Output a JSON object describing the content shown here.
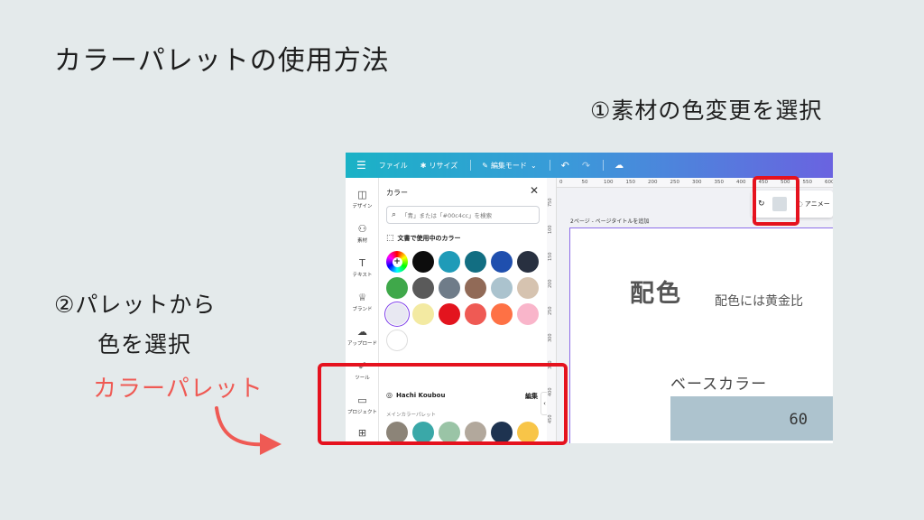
{
  "slide": {
    "title": "カラーパレットの使用方法",
    "step1": "①素材の色変更を選択",
    "step2_line1": "②パレットから",
    "step2_line2": "色を選択",
    "palette_label": "カラーパレット",
    "accent": "#ef5a54",
    "highlight": "#e5121e"
  },
  "topbar": {
    "menu_icon": "hamburger-icon",
    "file": "ファイル",
    "resize": "リサイズ",
    "edit_mode": "編集モード",
    "gradient_from": "#1ab2c6",
    "gradient_to": "#6a63e0"
  },
  "nav": [
    {
      "label": "デザイン",
      "icon": "design-icon"
    },
    {
      "label": "素材",
      "icon": "elements-icon"
    },
    {
      "label": "テキスト",
      "icon": "text-icon"
    },
    {
      "label": "ブランド",
      "icon": "brand-icon"
    },
    {
      "label": "アップロード",
      "icon": "upload-icon"
    },
    {
      "label": "ツール",
      "icon": "tools-icon"
    },
    {
      "label": "プロジェクト",
      "icon": "folder-icon"
    },
    {
      "label": "",
      "icon": "apps-icon"
    }
  ],
  "panel": {
    "header": "カラー",
    "search_placeholder": "「青」または「#00c4cc」を検索",
    "doc_colors_title": "文書で使用中のカラー",
    "doc_colors": [
      "#0d0d0d",
      "#1f9bb8",
      "#126e82",
      "#1f4fae",
      "#283040",
      "#3fa84a",
      "#5a5a5a",
      "#6f7c89",
      "#916a57",
      "#abc3ce",
      "#d6c3b0",
      "#e8e8f2",
      "#f3eaa2",
      "#e3141e",
      "#ef5a54",
      "#fe7145",
      "#f9b5ca",
      "#ffffff"
    ],
    "brand_name": "Hachi Koubou",
    "edit_label": "編集",
    "main_palette_label": "メインカラーパレット",
    "brand_colors": [
      "#8c8478",
      "#3aa8a8",
      "#9ac4a6",
      "#b2a89c",
      "#1e3350",
      "#f8c548",
      "#f06c45",
      "#8e6656",
      "#a8c46b",
      "#e86e82",
      "#1c6a7b",
      "#7c5c3a"
    ]
  },
  "ruler_h": [
    "0",
    "50",
    "100",
    "150",
    "200",
    "250",
    "300",
    "350",
    "400",
    "450",
    "500",
    "550",
    "600"
  ],
  "ruler_v": [
    "750",
    "100",
    "150",
    "200",
    "250",
    "300",
    "350",
    "400",
    "450",
    "500"
  ],
  "ctx": {
    "animate": "アニメー"
  },
  "canvas": {
    "page_label": "2ページ - ページタイトルを追加",
    "haishoku": "配色",
    "ratio_text": "配色には黄金比"
  },
  "base": {
    "label": "ベースカラー",
    "value": "60",
    "color": "#adc3ce"
  }
}
